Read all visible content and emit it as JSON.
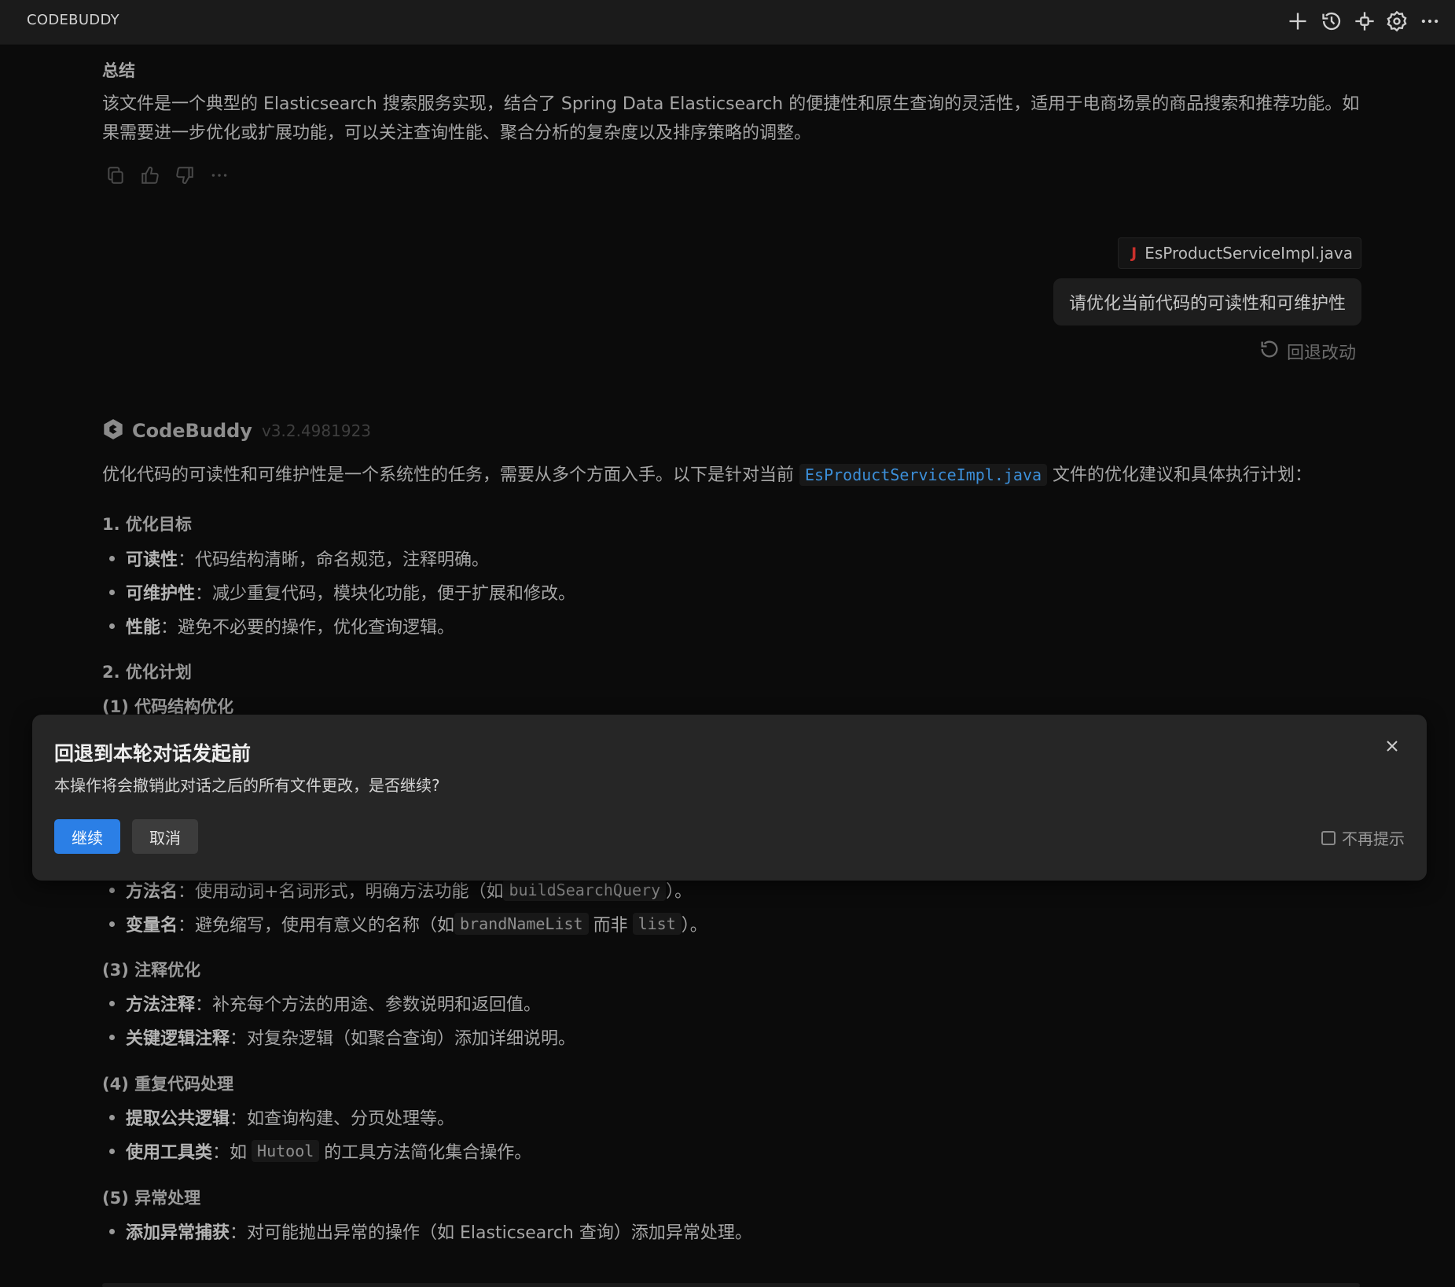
{
  "app_title": "CODEBUDDY",
  "toolbar_icons": [
    "plus-icon",
    "history-icon",
    "plugin-icon",
    "settings-icon",
    "more-icon"
  ],
  "summary": {
    "heading": "总结",
    "text": "该文件是一个典型的 Elasticsearch 搜索服务实现，结合了 Spring Data Elasticsearch 的便捷性和原生查询的灵活性，适用于电商场景的商品搜索和推荐功能。如果需要进一步优化或扩展功能，可以关注查询性能、聚合分析的复杂度以及排序策略的调整。"
  },
  "message_actions": [
    "copy-icon",
    "thumbs-up-icon",
    "thumbs-down-icon",
    "more-icon"
  ],
  "user_message": {
    "file_badge": "J",
    "file": "EsProductServiceImpl.java",
    "text": "请优化当前代码的可读性和可维护性",
    "revert_label": "回退改动"
  },
  "assistant": {
    "name": "CodeBuddy",
    "version": "v3.2.4981923",
    "intro_pre": "优化代码的可读性和可维护性是一个系统性的任务，需要从多个方面入手。以下是针对当前",
    "intro_code": "EsProductServiceImpl.java",
    "intro_post": "文件的优化建议和具体执行计划："
  },
  "sections": {
    "s1": {
      "title": "1. 优化目标",
      "items": [
        {
          "bold": "可读性",
          "text": "：代码结构清晰，命名规范，注释明确。"
        },
        {
          "bold": "可维护性",
          "text": "：减少重复代码，模块化功能，便于扩展和修改。"
        },
        {
          "bold": "性能",
          "text": "：避免不必要的操作，优化查询逻辑。"
        }
      ]
    },
    "s2": {
      "title": "2. 优化计划"
    },
    "s2_1": {
      "title": "(1) 代码结构优化"
    },
    "naming": {
      "method": {
        "bold": "方法名",
        "pre": "：使用动词+名词形式，明确方法功能（如",
        "code": "buildSearchQuery",
        "post": "）。"
      },
      "variable": {
        "bold": "变量名",
        "pre": "：避免缩写，使用有意义的名称（如",
        "code1": "brandNameList",
        "mid": "而非",
        "code2": "list",
        "post": "）。"
      }
    },
    "s2_3": {
      "title": "(3) 注释优化",
      "items": [
        {
          "bold": "方法注释",
          "text": "：补充每个方法的用途、参数说明和返回值。"
        },
        {
          "bold": "关键逻辑注释",
          "text": "：对复杂逻辑（如聚合查询）添加详细说明。"
        }
      ]
    },
    "s2_4": {
      "title": "(4) 重复代码处理",
      "item1": {
        "bold": "提取公共逻辑",
        "text": "：如查询构建、分页处理等。"
      },
      "item2": {
        "bold": "使用工具类",
        "pre": "：如",
        "code": "Hutool",
        "post": "的工具方法简化集合操作。"
      }
    },
    "s2_5": {
      "title": "(5) 异常处理",
      "item1": {
        "bold": "添加异常捕获",
        "text": "：对可能抛出异常的操作（如 Elasticsearch 查询）添加异常处理。"
      }
    }
  },
  "dialog": {
    "title": "回退到本轮对话发起前",
    "message": "本操作将会撤销此对话之后的所有文件更改，是否继续?",
    "continue_label": "继续",
    "cancel_label": "取消",
    "dont_show_label": "不再提示",
    "dont_show_checked": false
  },
  "colors": {
    "accent": "#2b7fe6",
    "code_link": "#3c8fd9",
    "java_badge": "#c9302c",
    "background": "#0b0b0b",
    "dialog_bg": "#262626"
  }
}
